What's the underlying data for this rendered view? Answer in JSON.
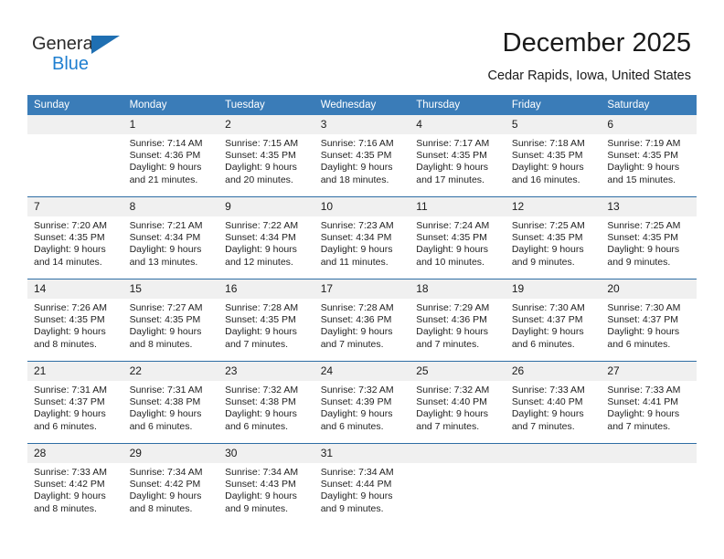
{
  "brand": {
    "name_part1": "General",
    "name_part2": "Blue",
    "logo_icon": "blue-triangle-icon",
    "accent_color": "#1f7fd0"
  },
  "header": {
    "title": "December 2025",
    "location": "Cedar Rapids, Iowa, United States"
  },
  "theme": {
    "header_row_bg": "#3a7cb8",
    "day_number_bg": "#f0f0f0",
    "row_divider": "#2e6da4",
    "text": "#1a1a1a"
  },
  "calendar": {
    "weekday_headers": [
      "Sunday",
      "Monday",
      "Tuesday",
      "Wednesday",
      "Thursday",
      "Friday",
      "Saturday"
    ],
    "weeks": [
      [
        {
          "day": "",
          "empty": true,
          "sunrise": "",
          "sunset": "",
          "daylight1": "",
          "daylight2": ""
        },
        {
          "day": "1",
          "empty": false,
          "sunrise": "Sunrise: 7:14 AM",
          "sunset": "Sunset: 4:36 PM",
          "daylight1": "Daylight: 9 hours",
          "daylight2": "and 21 minutes."
        },
        {
          "day": "2",
          "empty": false,
          "sunrise": "Sunrise: 7:15 AM",
          "sunset": "Sunset: 4:35 PM",
          "daylight1": "Daylight: 9 hours",
          "daylight2": "and 20 minutes."
        },
        {
          "day": "3",
          "empty": false,
          "sunrise": "Sunrise: 7:16 AM",
          "sunset": "Sunset: 4:35 PM",
          "daylight1": "Daylight: 9 hours",
          "daylight2": "and 18 minutes."
        },
        {
          "day": "4",
          "empty": false,
          "sunrise": "Sunrise: 7:17 AM",
          "sunset": "Sunset: 4:35 PM",
          "daylight1": "Daylight: 9 hours",
          "daylight2": "and 17 minutes."
        },
        {
          "day": "5",
          "empty": false,
          "sunrise": "Sunrise: 7:18 AM",
          "sunset": "Sunset: 4:35 PM",
          "daylight1": "Daylight: 9 hours",
          "daylight2": "and 16 minutes."
        },
        {
          "day": "6",
          "empty": false,
          "sunrise": "Sunrise: 7:19 AM",
          "sunset": "Sunset: 4:35 PM",
          "daylight1": "Daylight: 9 hours",
          "daylight2": "and 15 minutes."
        }
      ],
      [
        {
          "day": "7",
          "empty": false,
          "sunrise": "Sunrise: 7:20 AM",
          "sunset": "Sunset: 4:35 PM",
          "daylight1": "Daylight: 9 hours",
          "daylight2": "and 14 minutes."
        },
        {
          "day": "8",
          "empty": false,
          "sunrise": "Sunrise: 7:21 AM",
          "sunset": "Sunset: 4:34 PM",
          "daylight1": "Daylight: 9 hours",
          "daylight2": "and 13 minutes."
        },
        {
          "day": "9",
          "empty": false,
          "sunrise": "Sunrise: 7:22 AM",
          "sunset": "Sunset: 4:34 PM",
          "daylight1": "Daylight: 9 hours",
          "daylight2": "and 12 minutes."
        },
        {
          "day": "10",
          "empty": false,
          "sunrise": "Sunrise: 7:23 AM",
          "sunset": "Sunset: 4:34 PM",
          "daylight1": "Daylight: 9 hours",
          "daylight2": "and 11 minutes."
        },
        {
          "day": "11",
          "empty": false,
          "sunrise": "Sunrise: 7:24 AM",
          "sunset": "Sunset: 4:35 PM",
          "daylight1": "Daylight: 9 hours",
          "daylight2": "and 10 minutes."
        },
        {
          "day": "12",
          "empty": false,
          "sunrise": "Sunrise: 7:25 AM",
          "sunset": "Sunset: 4:35 PM",
          "daylight1": "Daylight: 9 hours",
          "daylight2": "and 9 minutes."
        },
        {
          "day": "13",
          "empty": false,
          "sunrise": "Sunrise: 7:25 AM",
          "sunset": "Sunset: 4:35 PM",
          "daylight1": "Daylight: 9 hours",
          "daylight2": "and 9 minutes."
        }
      ],
      [
        {
          "day": "14",
          "empty": false,
          "sunrise": "Sunrise: 7:26 AM",
          "sunset": "Sunset: 4:35 PM",
          "daylight1": "Daylight: 9 hours",
          "daylight2": "and 8 minutes."
        },
        {
          "day": "15",
          "empty": false,
          "sunrise": "Sunrise: 7:27 AM",
          "sunset": "Sunset: 4:35 PM",
          "daylight1": "Daylight: 9 hours",
          "daylight2": "and 8 minutes."
        },
        {
          "day": "16",
          "empty": false,
          "sunrise": "Sunrise: 7:28 AM",
          "sunset": "Sunset: 4:35 PM",
          "daylight1": "Daylight: 9 hours",
          "daylight2": "and 7 minutes."
        },
        {
          "day": "17",
          "empty": false,
          "sunrise": "Sunrise: 7:28 AM",
          "sunset": "Sunset: 4:36 PM",
          "daylight1": "Daylight: 9 hours",
          "daylight2": "and 7 minutes."
        },
        {
          "day": "18",
          "empty": false,
          "sunrise": "Sunrise: 7:29 AM",
          "sunset": "Sunset: 4:36 PM",
          "daylight1": "Daylight: 9 hours",
          "daylight2": "and 7 minutes."
        },
        {
          "day": "19",
          "empty": false,
          "sunrise": "Sunrise: 7:30 AM",
          "sunset": "Sunset: 4:37 PM",
          "daylight1": "Daylight: 9 hours",
          "daylight2": "and 6 minutes."
        },
        {
          "day": "20",
          "empty": false,
          "sunrise": "Sunrise: 7:30 AM",
          "sunset": "Sunset: 4:37 PM",
          "daylight1": "Daylight: 9 hours",
          "daylight2": "and 6 minutes."
        }
      ],
      [
        {
          "day": "21",
          "empty": false,
          "sunrise": "Sunrise: 7:31 AM",
          "sunset": "Sunset: 4:37 PM",
          "daylight1": "Daylight: 9 hours",
          "daylight2": "and 6 minutes."
        },
        {
          "day": "22",
          "empty": false,
          "sunrise": "Sunrise: 7:31 AM",
          "sunset": "Sunset: 4:38 PM",
          "daylight1": "Daylight: 9 hours",
          "daylight2": "and 6 minutes."
        },
        {
          "day": "23",
          "empty": false,
          "sunrise": "Sunrise: 7:32 AM",
          "sunset": "Sunset: 4:38 PM",
          "daylight1": "Daylight: 9 hours",
          "daylight2": "and 6 minutes."
        },
        {
          "day": "24",
          "empty": false,
          "sunrise": "Sunrise: 7:32 AM",
          "sunset": "Sunset: 4:39 PM",
          "daylight1": "Daylight: 9 hours",
          "daylight2": "and 6 minutes."
        },
        {
          "day": "25",
          "empty": false,
          "sunrise": "Sunrise: 7:32 AM",
          "sunset": "Sunset: 4:40 PM",
          "daylight1": "Daylight: 9 hours",
          "daylight2": "and 7 minutes."
        },
        {
          "day": "26",
          "empty": false,
          "sunrise": "Sunrise: 7:33 AM",
          "sunset": "Sunset: 4:40 PM",
          "daylight1": "Daylight: 9 hours",
          "daylight2": "and 7 minutes."
        },
        {
          "day": "27",
          "empty": false,
          "sunrise": "Sunrise: 7:33 AM",
          "sunset": "Sunset: 4:41 PM",
          "daylight1": "Daylight: 9 hours",
          "daylight2": "and 7 minutes."
        }
      ],
      [
        {
          "day": "28",
          "empty": false,
          "sunrise": "Sunrise: 7:33 AM",
          "sunset": "Sunset: 4:42 PM",
          "daylight1": "Daylight: 9 hours",
          "daylight2": "and 8 minutes."
        },
        {
          "day": "29",
          "empty": false,
          "sunrise": "Sunrise: 7:34 AM",
          "sunset": "Sunset: 4:42 PM",
          "daylight1": "Daylight: 9 hours",
          "daylight2": "and 8 minutes."
        },
        {
          "day": "30",
          "empty": false,
          "sunrise": "Sunrise: 7:34 AM",
          "sunset": "Sunset: 4:43 PM",
          "daylight1": "Daylight: 9 hours",
          "daylight2": "and 9 minutes."
        },
        {
          "day": "31",
          "empty": false,
          "sunrise": "Sunrise: 7:34 AM",
          "sunset": "Sunset: 4:44 PM",
          "daylight1": "Daylight: 9 hours",
          "daylight2": "and 9 minutes."
        },
        {
          "day": "",
          "empty": true,
          "sunrise": "",
          "sunset": "",
          "daylight1": "",
          "daylight2": ""
        },
        {
          "day": "",
          "empty": true,
          "sunrise": "",
          "sunset": "",
          "daylight1": "",
          "daylight2": ""
        },
        {
          "day": "",
          "empty": true,
          "sunrise": "",
          "sunset": "",
          "daylight1": "",
          "daylight2": ""
        }
      ]
    ]
  }
}
